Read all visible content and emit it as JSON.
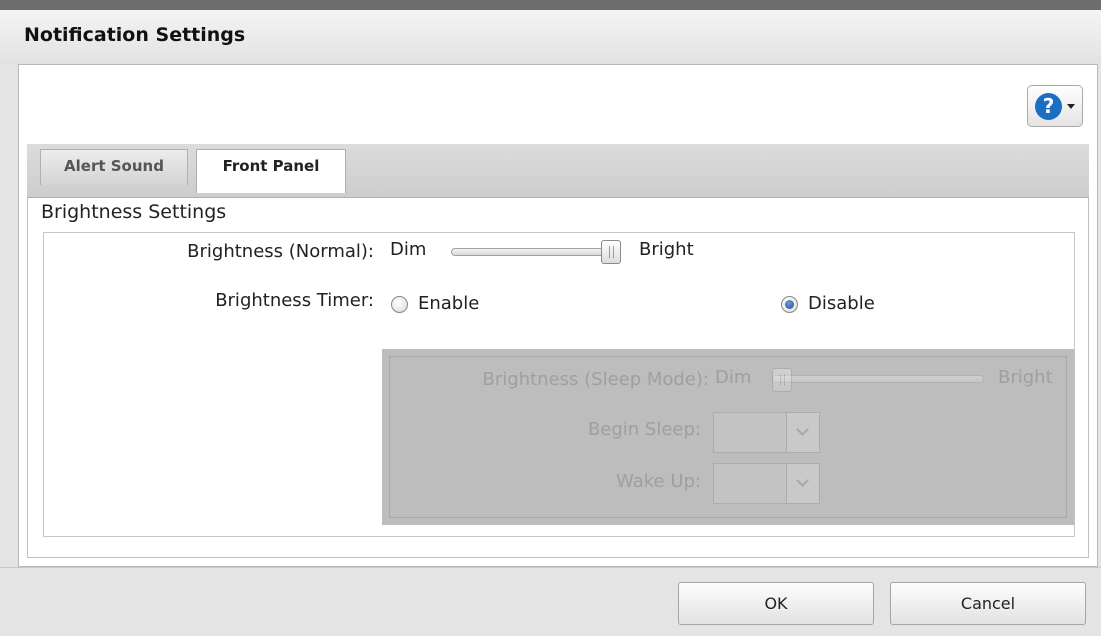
{
  "window": {
    "title": "Notification Settings"
  },
  "help": {
    "icon": "help-icon",
    "label": "?"
  },
  "tabs": [
    {
      "label": "Alert Sound",
      "active": false
    },
    {
      "label": "Front Panel",
      "active": true
    }
  ],
  "brightness_settings": {
    "section_title": "Brightness Settings",
    "normal": {
      "label": "Brightness (Normal):",
      "min_label": "Dim",
      "max_label": "Bright",
      "value": 1.0
    },
    "timer": {
      "label": "Brightness Timer:",
      "options": [
        {
          "label": "Enable",
          "checked": false
        },
        {
          "label": "Disable",
          "checked": true
        }
      ]
    },
    "sleep": {
      "disabled": true,
      "brightness_label": "Brightness (Sleep Mode):",
      "min_label": "Dim",
      "max_label": "Bright",
      "value": 0.0,
      "begin_sleep_label": "Begin Sleep:",
      "begin_sleep_value": "",
      "wake_up_label": "Wake Up:",
      "wake_up_value": ""
    }
  },
  "footer": {
    "ok_label": "OK",
    "cancel_label": "Cancel"
  }
}
